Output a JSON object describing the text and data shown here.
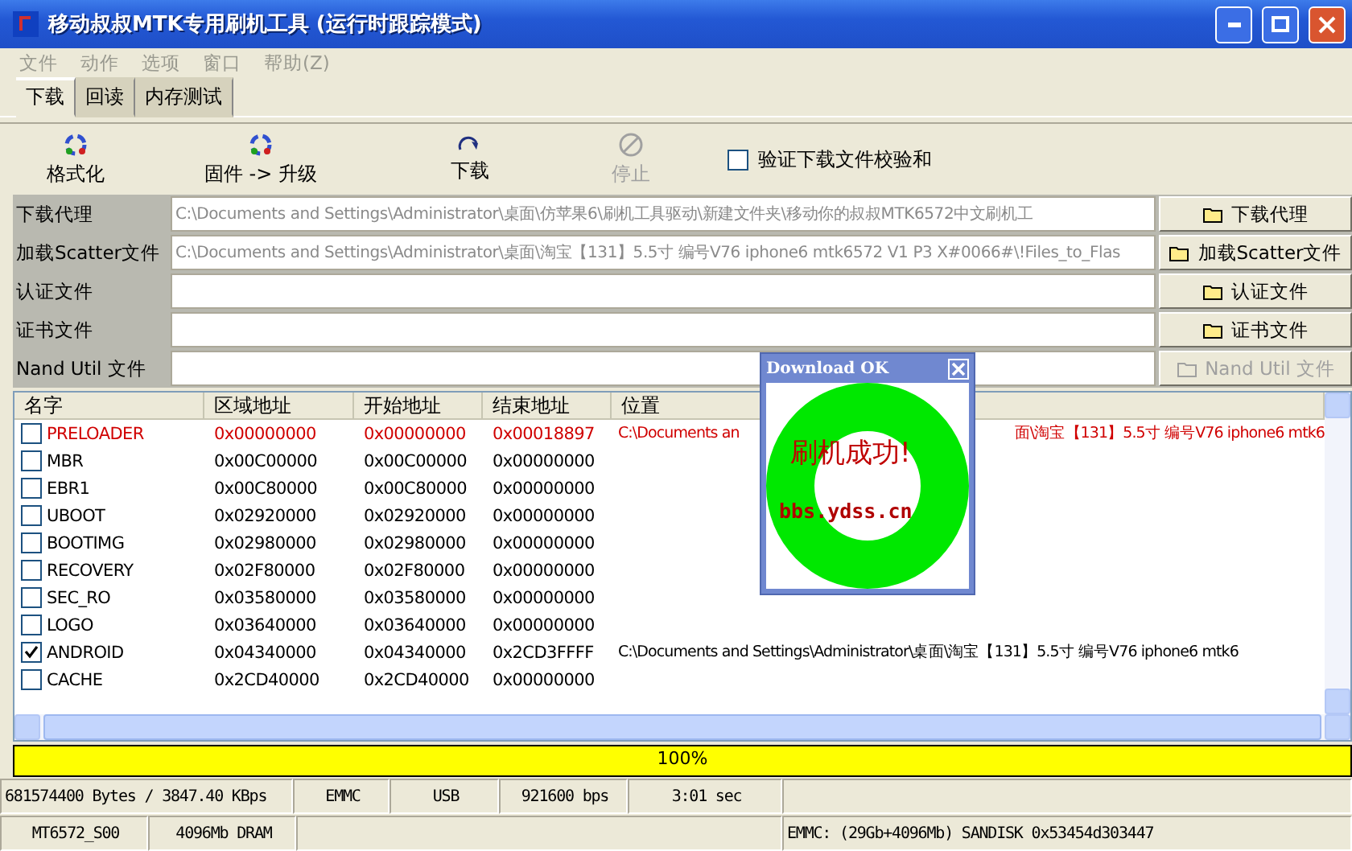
{
  "window": {
    "title": "移动叔叔MTK专用刷机工具 (运行时跟踪模式)"
  },
  "menu": [
    {
      "label": "文件",
      "disabled": true
    },
    {
      "label": "动作",
      "disabled": true
    },
    {
      "label": "选项",
      "disabled": true
    },
    {
      "label": "窗口",
      "disabled": true
    },
    {
      "label": "帮助(Z)",
      "disabled": true
    }
  ],
  "tabs": [
    {
      "label": "下载",
      "selected": true
    },
    {
      "label": "回读",
      "selected": false
    },
    {
      "label": "内存测试",
      "selected": false
    }
  ],
  "toolbar": {
    "buttons": [
      {
        "label": "格式化",
        "kind": "recycle",
        "disabled": false
      },
      {
        "label": "固件 -> 升级",
        "kind": "recycle",
        "disabled": false
      },
      {
        "label": "下载",
        "kind": "arrow",
        "disabled": false
      },
      {
        "label": "停止",
        "kind": "stop",
        "disabled": true
      }
    ],
    "checksum": {
      "label": "验证下载文件校验和",
      "checked": false
    }
  },
  "files": [
    {
      "label": "下载代理",
      "value": "C:\\Documents and Settings\\Administrator\\桌面\\仿苹果6\\刷机工具驱动\\新建文件夹\\移动你的叔叔MTK6572中文刷机工",
      "button": "下载代理",
      "disabled": false
    },
    {
      "label": "加载Scatter文件",
      "value": "C:\\Documents and Settings\\Administrator\\桌面\\淘宝【131】5.5寸 编号V76 iphone6 mtk6572 V1 P3 X#0066#\\!Files_to_Flas",
      "button": "加载Scatter文件",
      "disabled": false
    },
    {
      "label": "认证文件",
      "button": "认证文件",
      "disabled": false
    },
    {
      "label": "证书文件",
      "button": "证书文件",
      "disabled": false
    },
    {
      "label": "Nand Util 文件",
      "button": "Nand Util 文件",
      "disabled": true
    }
  ],
  "table": {
    "columns": [
      "名字",
      "区域地址",
      "开始地址",
      "结束地址",
      "位置"
    ],
    "rows": [
      {
        "name": "PRELOADER",
        "region": "0x00000000",
        "start": "0x00000000",
        "end": "0x00018897",
        "location": [
          "C:\\Documents an",
          "面\\淘宝【131】5.5寸 编号V76 iphone6 mtk6"
        ],
        "checked": false,
        "highlighted": true
      },
      {
        "name": "MBR",
        "region": "0x00C00000",
        "start": "0x00C00000",
        "end": "0x00000000",
        "checked": false,
        "highlighted": false
      },
      {
        "name": "EBR1",
        "region": "0x00C80000",
        "start": "0x00C80000",
        "end": "0x00000000",
        "checked": false,
        "highlighted": false
      },
      {
        "name": "UBOOT",
        "region": "0x02920000",
        "start": "0x02920000",
        "end": "0x00000000",
        "checked": false,
        "highlighted": false
      },
      {
        "name": "BOOTIMG",
        "region": "0x02980000",
        "start": "0x02980000",
        "end": "0x00000000",
        "checked": false,
        "highlighted": false
      },
      {
        "name": "RECOVERY",
        "region": "0x02F80000",
        "start": "0x02F80000",
        "end": "0x00000000",
        "checked": false,
        "highlighted": false
      },
      {
        "name": "SEC_RO",
        "region": "0x03580000",
        "start": "0x03580000",
        "end": "0x00000000",
        "checked": false,
        "highlighted": false
      },
      {
        "name": "LOGO",
        "region": "0x03640000",
        "start": "0x03640000",
        "end": "0x00000000",
        "checked": false,
        "highlighted": false
      },
      {
        "name": "ANDROID",
        "region": "0x04340000",
        "start": "0x04340000",
        "end": "0x2CD3FFFF",
        "location": "C:\\Documents and Settings\\Administrator\\桌面\\淘宝【131】5.5寸 编号V76 iphone6 mtk6",
        "checked": true,
        "highlighted": false
      },
      {
        "name": "CACHE",
        "region": "0x2CD40000",
        "start": "0x2CD40000",
        "end": "0x00000000",
        "checked": false,
        "highlighted": false
      }
    ]
  },
  "progress": {
    "level": 1,
    "label": "100%"
  },
  "status_bar": [
    {
      "left": [
        "681574400 Bytes / 3847.40 KBps",
        "EMMC",
        "USB",
        "921600 bps",
        "3:01 sec"
      ]
    },
    {
      "left": [
        "MT6572_S00",
        "4096Mb DRAM"
      ],
      "right": "EMMC: (29Gb+4096Mb) SANDISK 0x53454d303447"
    }
  ],
  "popup": {
    "title": "Download OK",
    "message": "刷机成功!",
    "site": "bbs.ydss.cn"
  }
}
